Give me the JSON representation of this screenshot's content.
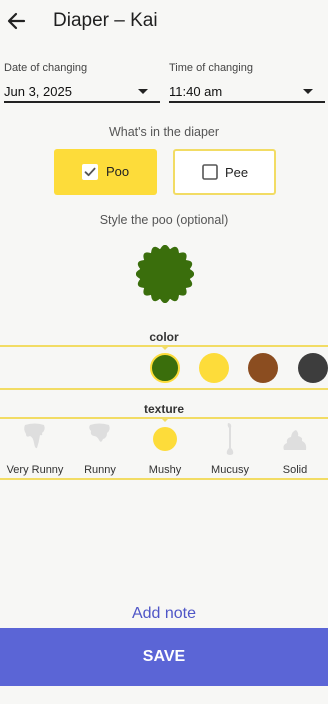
{
  "app_bar": {
    "title": "Diaper – Kai",
    "back_icon": "arrow-left-icon"
  },
  "date_field": {
    "label": "Date of changing",
    "value": "Jun 3, 2025"
  },
  "time_field": {
    "label": "Time of changing",
    "value": "11:40 am"
  },
  "contents": {
    "heading": "What's in the diaper",
    "options": [
      {
        "label": "Poo",
        "checked": true
      },
      {
        "label": "Pee",
        "checked": false
      }
    ]
  },
  "style_heading": "Style the poo (optional)",
  "preview_color": "#3a6e0c",
  "color_picker": {
    "label": "color",
    "swatches": [
      "#3a6e0c",
      "#fddc3a",
      "#8b4d20",
      "#3d3d3d"
    ],
    "selected_index": 0
  },
  "texture_picker": {
    "label": "texture",
    "options": [
      {
        "label": "Very Runny",
        "icon": "very-runny-icon"
      },
      {
        "label": "Runny",
        "icon": "runny-icon"
      },
      {
        "label": "Mushy",
        "icon": "mushy-icon"
      },
      {
        "label": "Mucusy",
        "icon": "mucusy-icon"
      },
      {
        "label": "Solid",
        "icon": "solid-icon"
      }
    ],
    "selected_index": 2
  },
  "add_note": "Add note",
  "save_label": "SAVE",
  "colors": {
    "accent_yellow": "#fddc3a",
    "primary": "#5b65d6",
    "link": "#4f56c7"
  }
}
